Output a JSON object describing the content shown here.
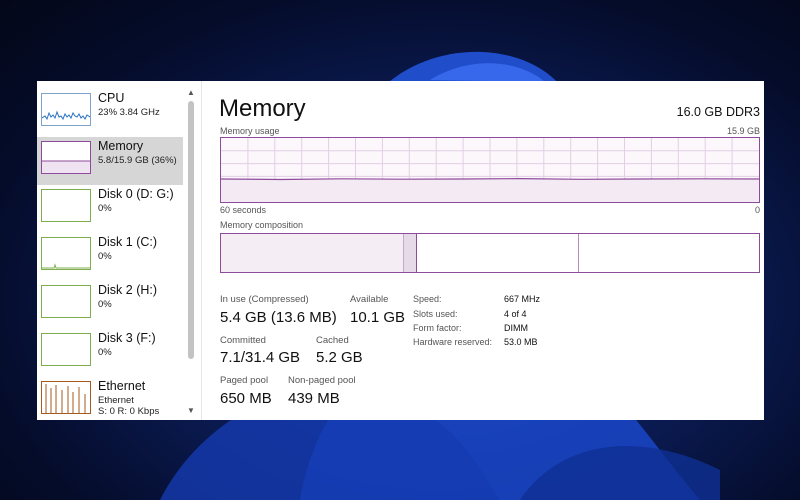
{
  "colors": {
    "memory_accent": "#8f4b9b",
    "cpu_accent": "#2b72c2",
    "disk_accent": "#7fae4f",
    "ethernet_accent": "#a55a1f",
    "selected_bg": "#d6d6d6"
  },
  "sidebar": {
    "items": [
      {
        "title": "CPU",
        "sub": "23%  3.84 GHz",
        "selected": false
      },
      {
        "title": "Memory",
        "sub": "5.8/15.9 GB (36%)",
        "selected": true
      },
      {
        "title": "Disk 0 (D: G:)",
        "sub": "0%",
        "selected": false
      },
      {
        "title": "Disk 1 (C:)",
        "sub": "0%",
        "selected": false
      },
      {
        "title": "Disk 2 (H:)",
        "sub": "0%",
        "selected": false
      },
      {
        "title": "Disk 3 (F:)",
        "sub": "0%",
        "selected": false
      },
      {
        "title": "Ethernet",
        "sub": "Ethernet",
        "sub2": "S: 0 R: 0 Kbps",
        "selected": false
      }
    ],
    "scroll_up_icon": "chevron-up-icon",
    "scroll_down_icon": "chevron-down-icon"
  },
  "main": {
    "title": "Memory",
    "spec": "16.0 GB DDR3",
    "usage_graph": {
      "label": "Memory usage",
      "max_label": "15.9 GB",
      "time_label": "60 seconds",
      "min_label": "0",
      "usage_percent": 36
    },
    "composition_label": "Memory composition",
    "stats": {
      "in_use_label": "In use (Compressed)",
      "in_use_value": "5.4 GB (13.6 MB)",
      "available_label": "Available",
      "available_value": "10.1 GB",
      "committed_label": "Committed",
      "committed_value": "7.1/31.4 GB",
      "cached_label": "Cached",
      "cached_value": "5.2 GB",
      "paged_label": "Paged pool",
      "paged_value": "650 MB",
      "nonpaged_label": "Non-paged pool",
      "nonpaged_value": "439 MB"
    },
    "properties": {
      "speed_label": "Speed:",
      "speed_value": "667 MHz",
      "slots_label": "Slots used:",
      "slots_value": "4 of 4",
      "form_label": "Form factor:",
      "form_value": "DIMM",
      "reserved_label": "Hardware reserved:",
      "reserved_value": "53.0 MB"
    }
  }
}
